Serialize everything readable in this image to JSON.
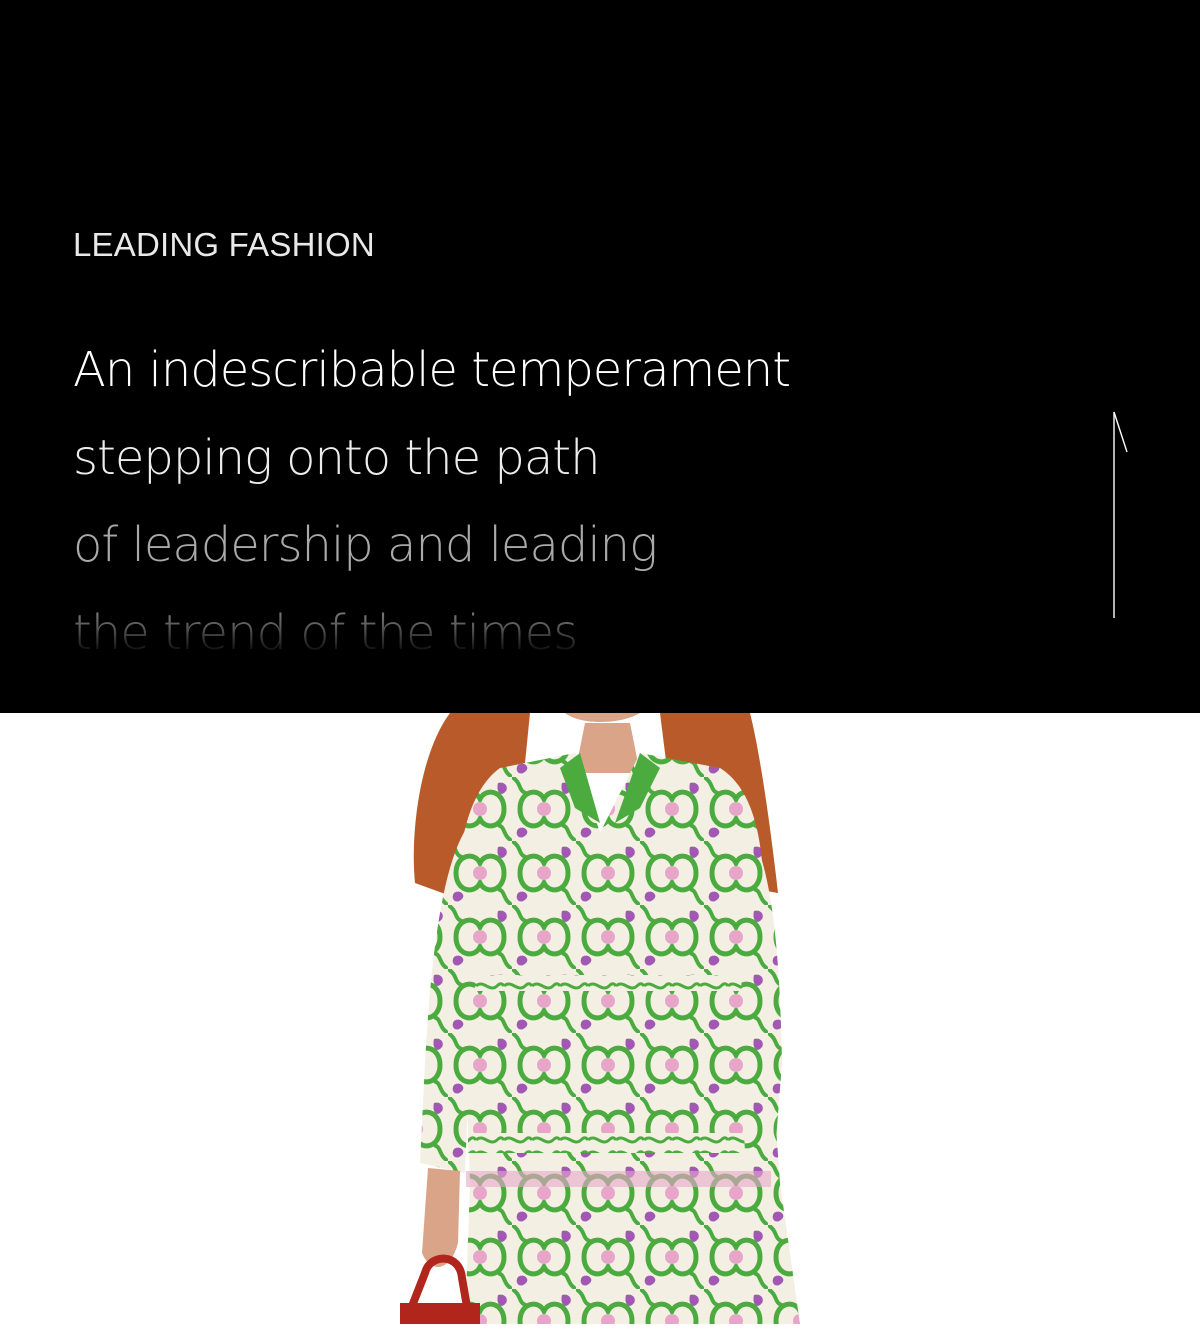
{
  "hero": {
    "eyebrow": "LEADING FASHION",
    "headline_lines": [
      "An indescribable temperament",
      "stepping onto the path",
      "of leadership and leading",
      "the trend of the times"
    ]
  },
  "scroll_indicator": {
    "icon": "up-arrow-line-icon"
  },
  "photo": {
    "colors": {
      "hair": "#b85a2a",
      "dress_base": "#f3efe2",
      "dress_green": "#4cab3f",
      "dress_pink": "#e7a6c9",
      "dress_purple": "#a158b3",
      "bag": "#b0261c"
    }
  }
}
